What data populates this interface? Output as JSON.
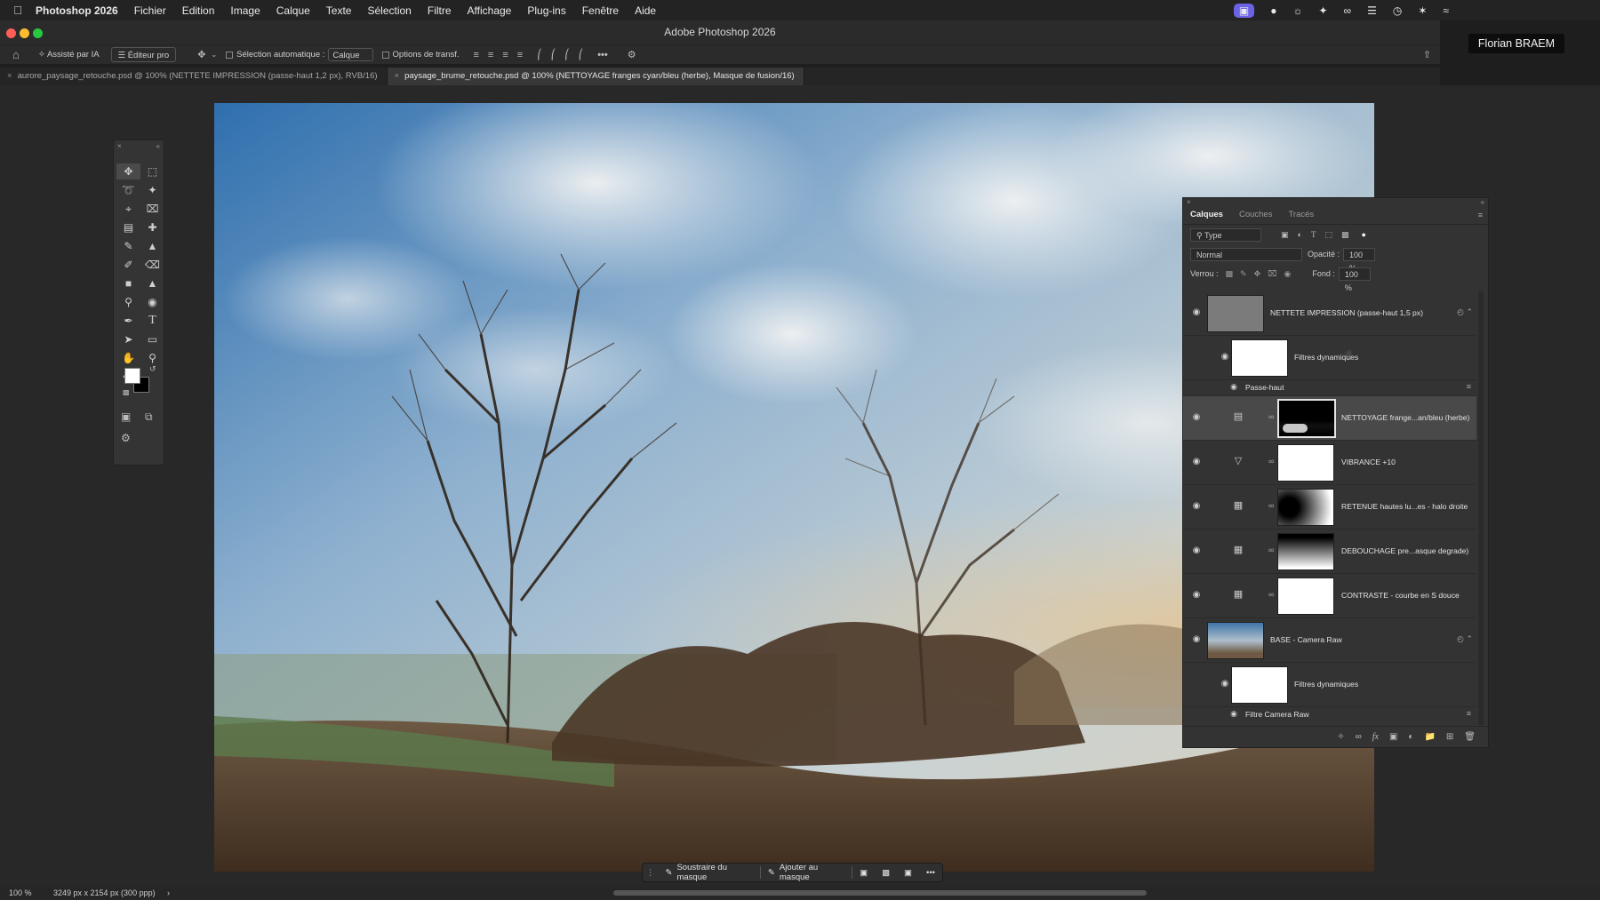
{
  "menubar": {
    "app_name": "Photoshop 2026",
    "items": [
      "Fichier",
      "Edition",
      "Image",
      "Calque",
      "Texte",
      "Sélection",
      "Filtre",
      "Affichage",
      "Plug-ins",
      "Fenêtre",
      "Aide"
    ]
  },
  "window": {
    "title": "Adobe Photoshop 2026"
  },
  "options_bar": {
    "ai_assist": "Assisté par IA",
    "pro_editor": "Éditeur pro",
    "auto_select": "Sélection automatique :",
    "auto_select_target": "Calque",
    "transform_options": "Options de transf."
  },
  "tabs": [
    {
      "label": "aurore_paysage_retouche.psd @ 100% (NETTETE IMPRESSION (passe-haut 1,2 px), RVB/16)"
    },
    {
      "label": "paysage_brume_retouche.psd @ 100% (NETTOYAGE franges cyan/bleu (herbe), Masque de fusion/16)"
    }
  ],
  "user": {
    "name": "Florian BRAEM"
  },
  "layers_panel": {
    "tabs": [
      "Calques",
      "Couches",
      "Tracés"
    ],
    "filter_type": "Type",
    "blend_mode": "Normal",
    "opacity_label": "Opacité :",
    "opacity_value": "100 %",
    "lock_label": "Verrou :",
    "fill_label": "Fond :",
    "fill_value": "100 %",
    "layers": [
      {
        "name": "NETTETE IMPRESSION (passe-haut 1,5 px)"
      },
      {
        "name": "Filtres dynamiques"
      },
      {
        "name": "Passe-haut"
      },
      {
        "name": "NETTOYAGE frange...an/bleu (herbe)"
      },
      {
        "name": "VIBRANCE +10"
      },
      {
        "name": "RETENUE hautes lu...es - halo droite"
      },
      {
        "name": "DEBOUCHAGE pre...asque degrade)"
      },
      {
        "name": "CONTRASTE - courbe en S douce"
      },
      {
        "name": "BASE - Camera Raw"
      },
      {
        "name": "Filtres dynamiques"
      },
      {
        "name": "Filtre Camera Raw"
      }
    ]
  },
  "taskbar": {
    "subtract": "Soustraire du masque",
    "add": "Ajouter au masque"
  },
  "status": {
    "zoom": "100 %",
    "doc_size": "3249 px x 2154 px (300 ppp)"
  }
}
